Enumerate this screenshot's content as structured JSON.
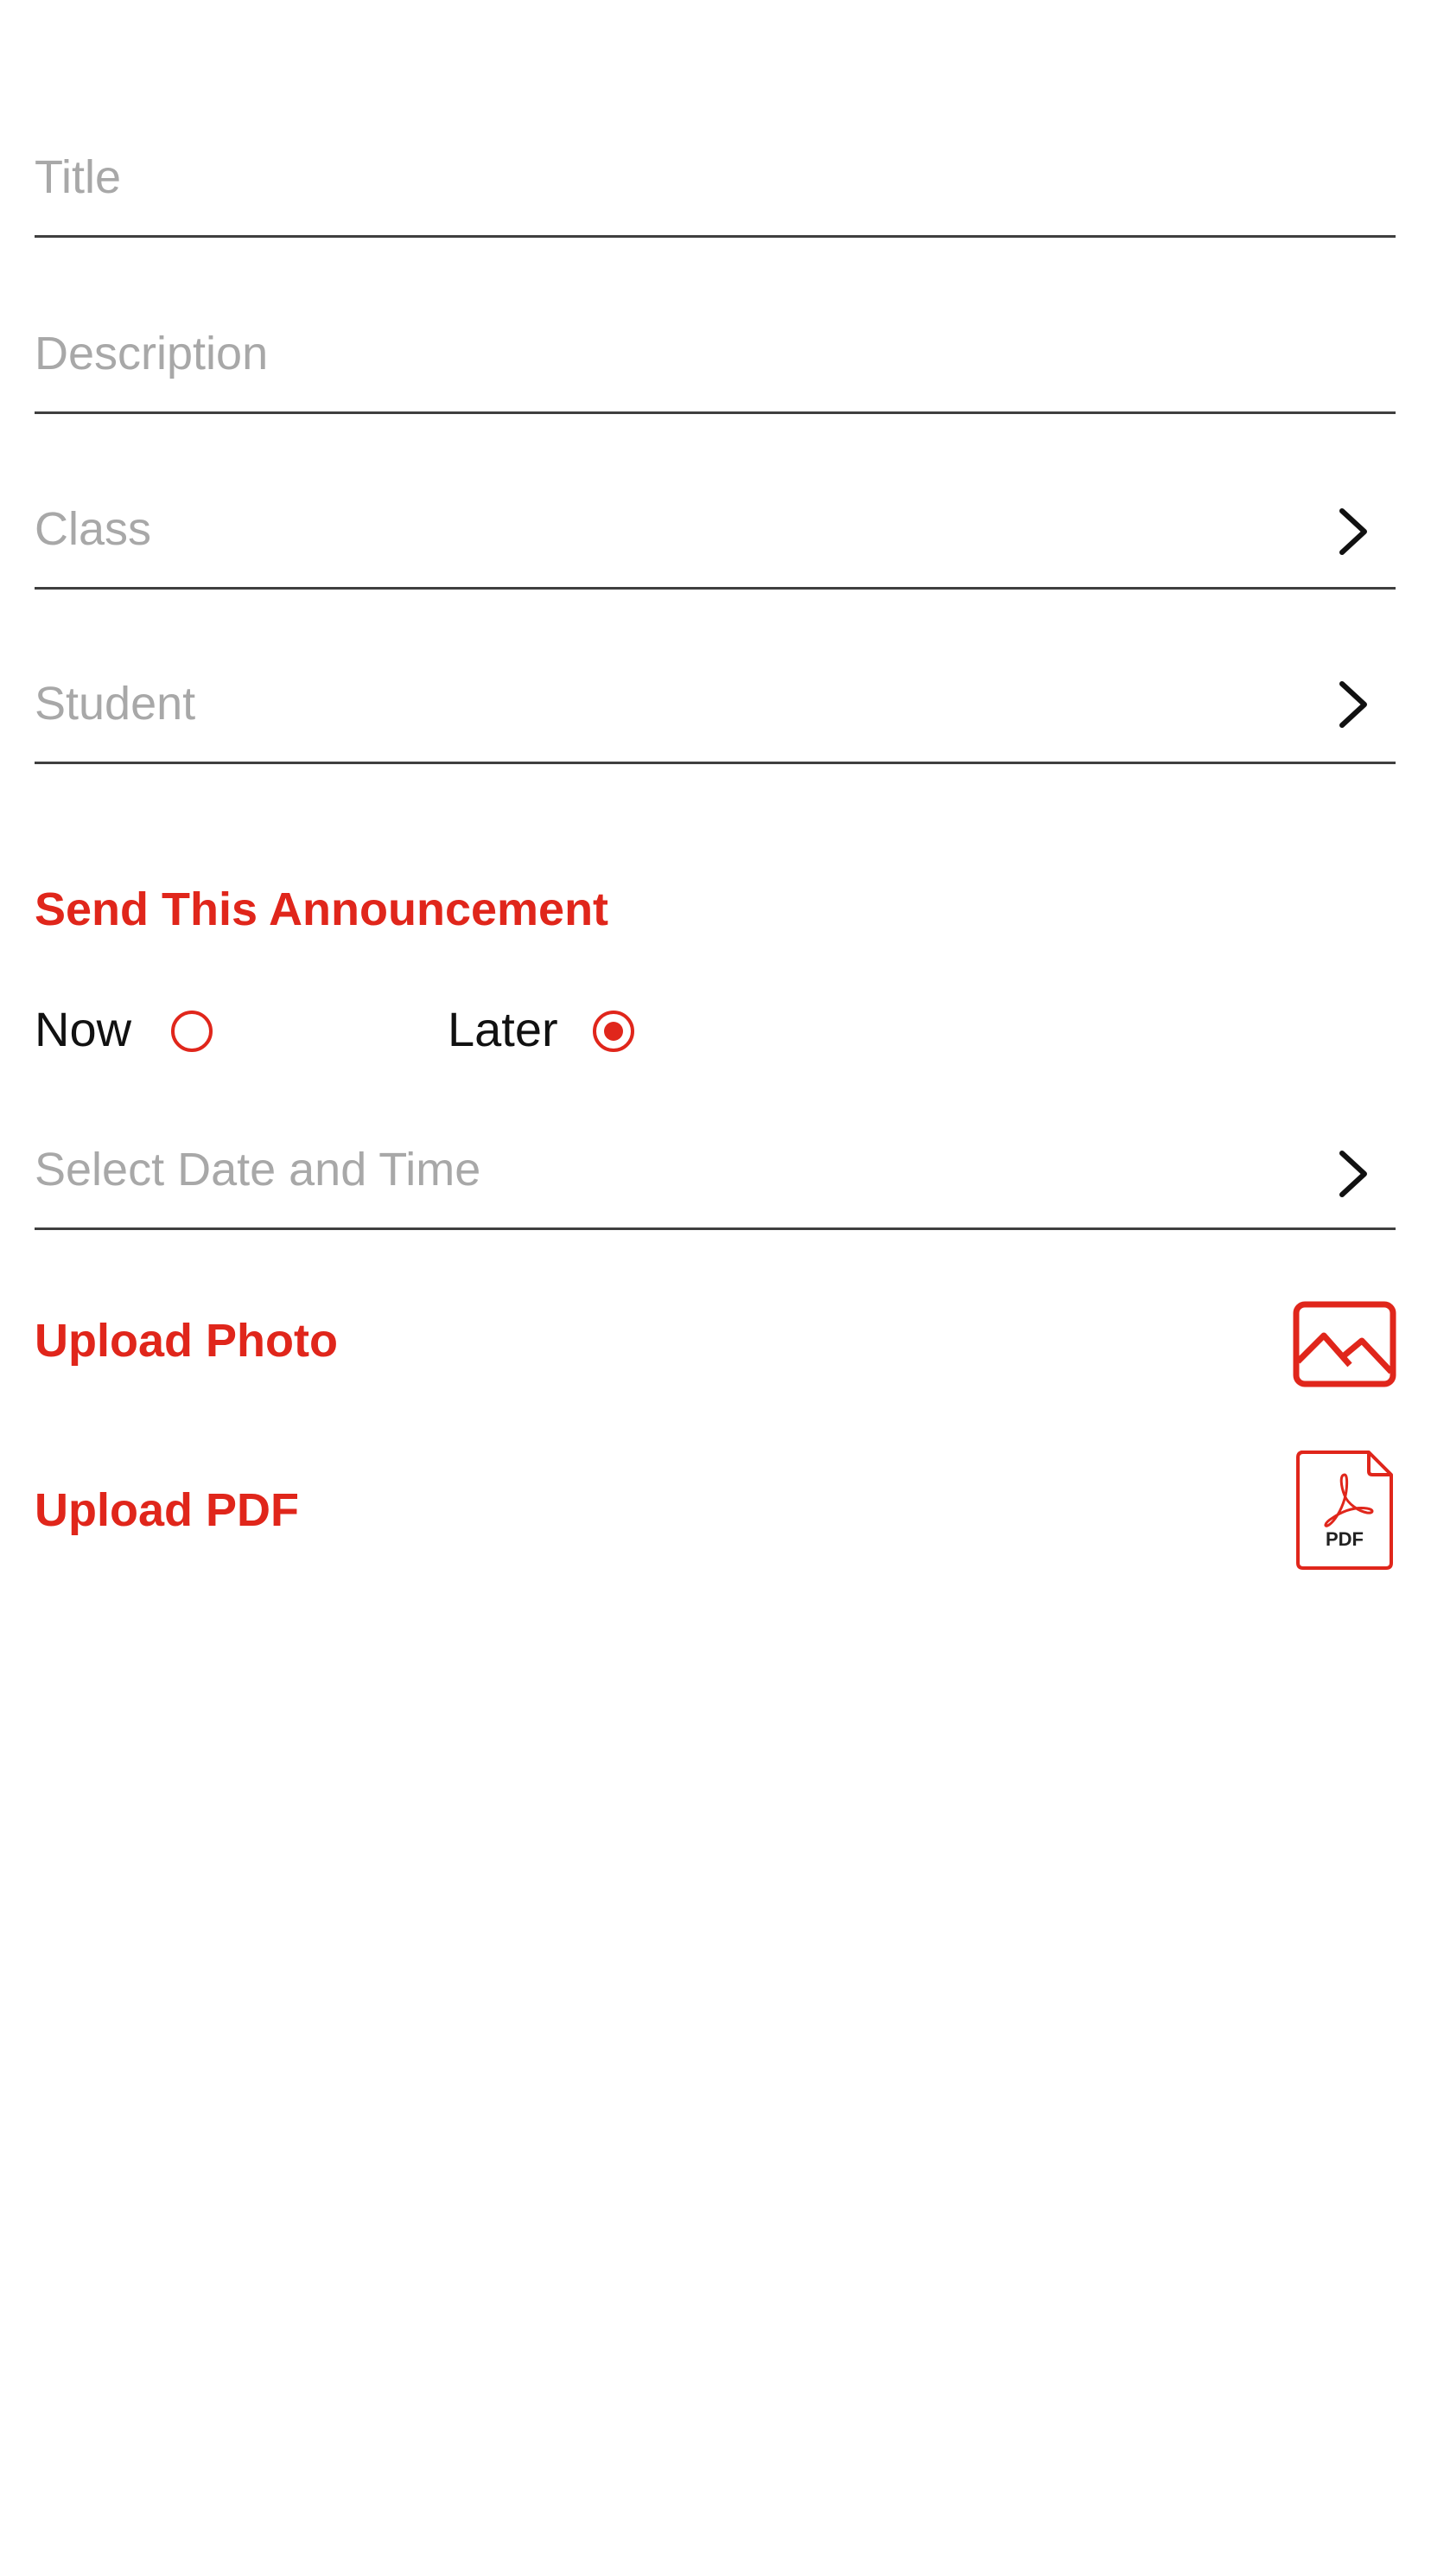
{
  "form": {
    "title_placeholder": "Title",
    "description_placeholder": "Description",
    "class_placeholder": "Class",
    "student_placeholder": "Student",
    "datetime_placeholder": "Select Date and Time"
  },
  "schedule": {
    "heading": "Send This Announcement",
    "now_label": "Now",
    "later_label": "Later",
    "selected": "Later"
  },
  "uploads": {
    "photo_label": "Upload Photo",
    "pdf_label": "Upload PDF",
    "pdf_icon_text": "PDF"
  },
  "icons": {
    "chevron": "chevron-right-icon",
    "photo": "image-icon",
    "pdf": "pdf-file-icon"
  },
  "colors": {
    "accent": "#e0261b",
    "placeholder": "#a8a8a8",
    "divider": "#3f3f3f",
    "text": "#111111"
  }
}
